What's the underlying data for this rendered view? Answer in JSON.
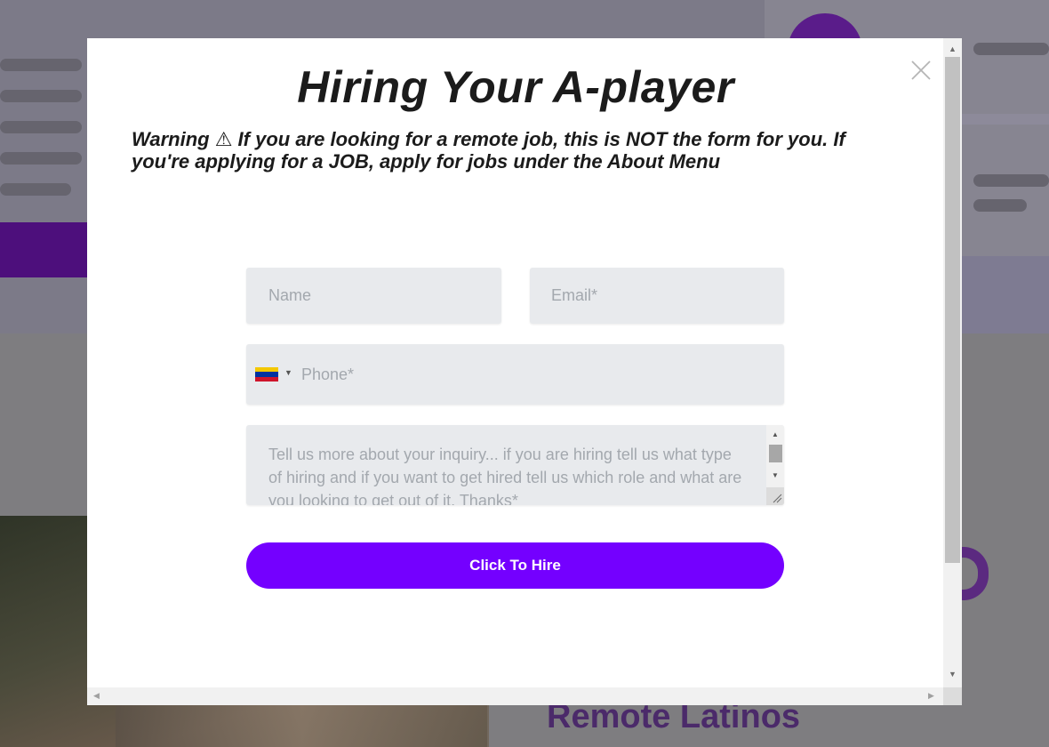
{
  "modal": {
    "title": "Hiring Your A-player",
    "warning": "Warning ⚠ If you are looking for a remote job, this is NOT the form for you. If you're applying for a JOB, apply for jobs under the About Menu",
    "close_icon": "close-icon"
  },
  "form": {
    "name_placeholder": "Name",
    "email_placeholder": "Email*",
    "phone_placeholder": "Phone*",
    "country_flag": "venezuela-flag-icon",
    "message_placeholder": "Tell us more about your inquiry... if you are hiring tell us what type of hiring and if you want to get hired tell us which role and what are you looking to get out of it. Thanks*",
    "submit_label": "Click To Hire"
  },
  "background": {
    "heading_fragment": "Remote Latinos"
  },
  "colors": {
    "accent": "#7400ff",
    "field_bg": "#e8eaed",
    "overlay": "#7d7b86"
  }
}
